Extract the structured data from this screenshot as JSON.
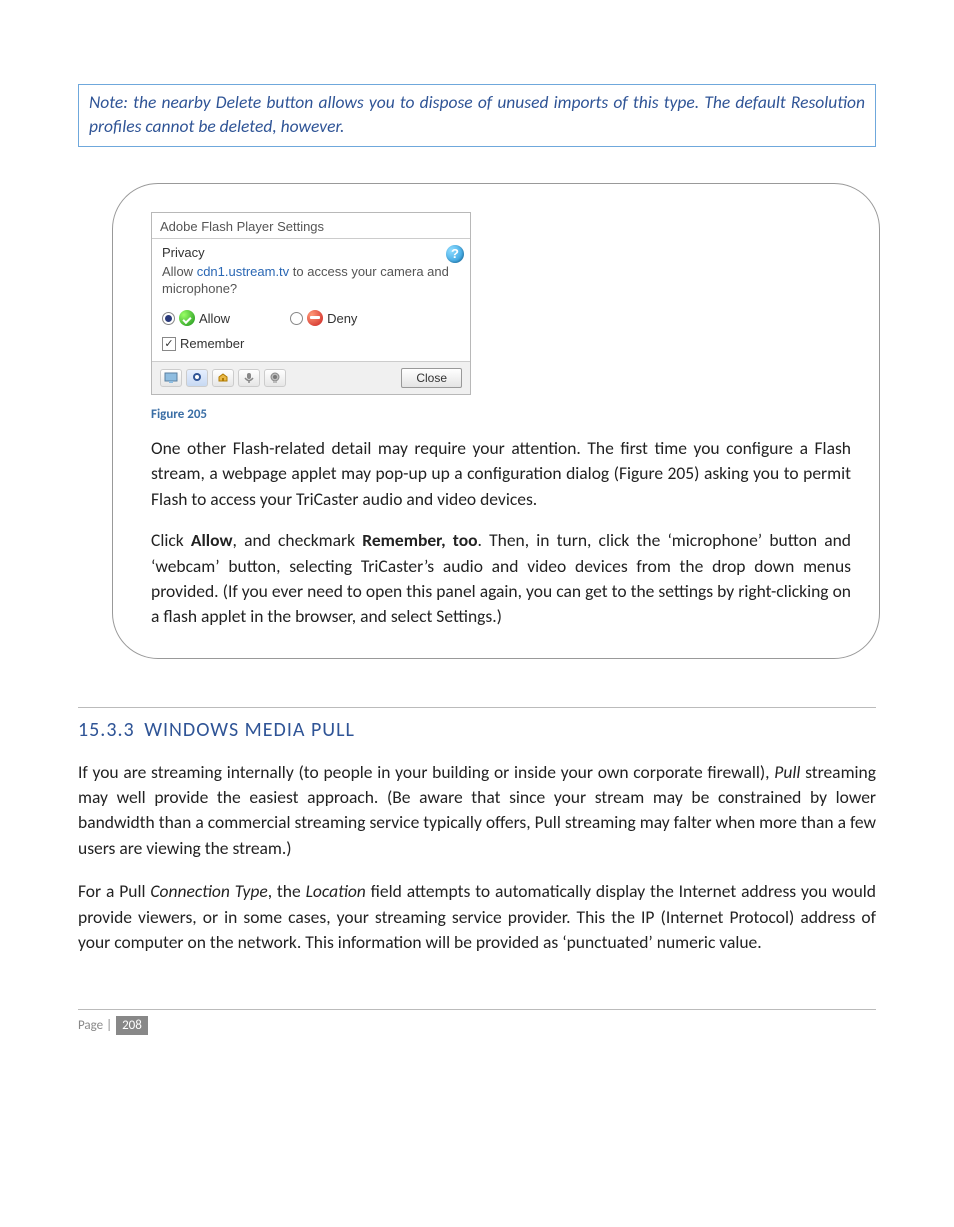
{
  "note": {
    "text": "Note: the nearby Delete button allows you to dispose of unused imports of this type.  The default Resolution profiles cannot be deleted, however."
  },
  "flash": {
    "window_title": "Adobe Flash Player Settings",
    "section": "Privacy",
    "prompt_pre": "Allow ",
    "prompt_link": "cdn1.ustream.tv",
    "prompt_post": " to access your camera and microphone?",
    "allow_label": "Allow",
    "deny_label": "Deny",
    "remember_label": "Remember",
    "close_label": "Close"
  },
  "figure_caption": "Figure 205",
  "callout": {
    "p1": "One other Flash-related detail may require your attention. The first time you configure a Flash stream, a webpage applet may pop-up up a configuration dialog (Figure 205) asking you to permit Flash to access your TriCaster audio and video devices.",
    "p2_pre": "Click ",
    "p2_allow": "Allow",
    "p2_mid": ", and checkmark ",
    "p2_remember": "Remember, too",
    "p2_post": ". Then, in turn, click the ‘microphone’ button and ‘webcam’ button, selecting TriCaster’s audio and video devices from the drop down menus provided.  (If you ever need to open this panel again, you can get to the settings by right-clicking on a flash applet in the browser, and select Settings.)"
  },
  "section": {
    "number": "15.3.3",
    "title": "WINDOWS MEDIA PULL"
  },
  "para1_pre": "If you are streaming internally (to people in your building or inside your own corporate firewall), ",
  "para1_pull": "Pull",
  "para1_post": " streaming may well provide the easiest approach.  (Be aware that since your stream may be constrained by lower bandwidth than a commercial streaming service typically offers, Pull streaming may falter when more than a few users are viewing the stream.)",
  "para2_pre": "For a Pull ",
  "para2_ct": "Connection Type",
  "para2_mid": ", the ",
  "para2_loc": "Location",
  "para2_post": " field attempts to automatically display the Internet address you would provide viewers, or in some cases, your streaming service provider. This the IP (Internet Protocol) address of your computer on the network. This information will be provided as ‘punctuated’ numeric value.",
  "footer": {
    "label": "Page | ",
    "number": "208"
  }
}
